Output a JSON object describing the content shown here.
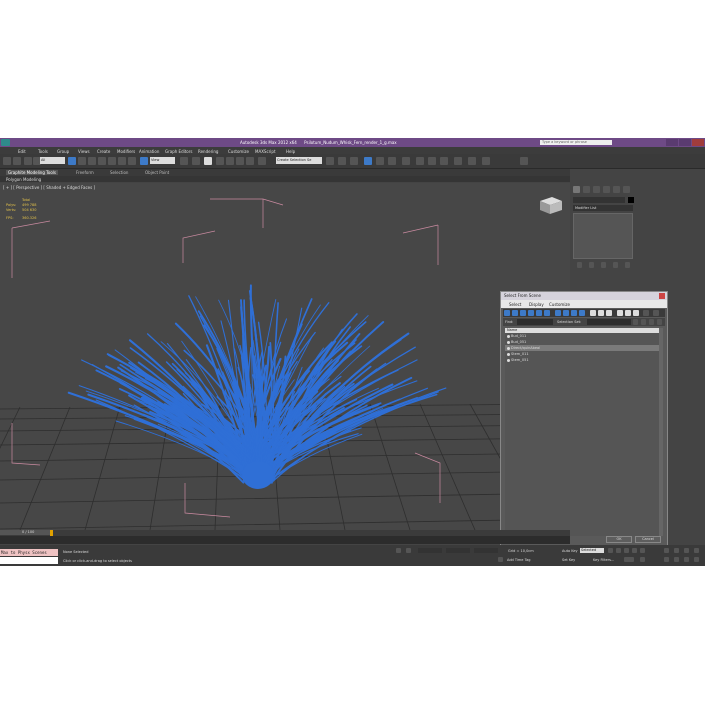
{
  "titlebar": {
    "app_title": "Autodesk 3ds Max 2012 x64",
    "file_name": "Psilotum_Nudum_Whisk_Fern_render_1_g.max",
    "search_placeholder": "Type a keyword or phrase"
  },
  "menubar": {
    "items": [
      "Edit",
      "Tools",
      "Group",
      "Views",
      "Create",
      "Modifiers",
      "Animation",
      "Graph Editors",
      "Rendering",
      "Customize",
      "MAXScript",
      "Help"
    ]
  },
  "toolbar": {
    "filter_value": "All",
    "view_value": "View",
    "selection_set_value": "Create Selection Se"
  },
  "ribbon": {
    "tabs": [
      "Graphite Modeling Tools",
      "Freeform",
      "Selection",
      "Object Paint"
    ],
    "sub_label": "Polygon Modeling"
  },
  "viewport": {
    "label": "[ + ] [ Perspective ] [ Shaded + Edged Faces ]",
    "stats": {
      "total_label": "Total",
      "polys_label": "Polys:",
      "polys_value": "499 788",
      "verts_label": "Verts:",
      "verts_value": "504 630",
      "fps_label": "FPS:",
      "fps_value": "360.326"
    }
  },
  "command_panel": {
    "modifier_list": "Modifier List"
  },
  "dialog": {
    "title": "Select From Scene",
    "menu": [
      "Select",
      "Display",
      "Customize"
    ],
    "find_label": "Find:",
    "selection_set_label": "Selection Set:",
    "list_header": "Name",
    "items": [
      {
        "name": "Bud_011",
        "selected": false
      },
      {
        "name": "Bud_051",
        "selected": false
      },
      {
        "name": "Direct/quinAbeal",
        "selected": true
      },
      {
        "name": "Stem_011",
        "selected": false
      },
      {
        "name": "Stem_051",
        "selected": false
      }
    ],
    "ok_label": "OK",
    "cancel_label": "Cancel"
  },
  "timeline": {
    "frame_display": "0 / 100"
  },
  "statusbar": {
    "maxscript_line1": "Max to Physx Scenes",
    "status_selected": "None Selected",
    "prompt": "Click or click-and-drag to select objects",
    "grid_label": "Grid = 10,0cm",
    "add_time_tag": "Add Time Tag",
    "auto_key": "Auto Key",
    "set_key": "Set Key",
    "selected_dropdown": "Selected",
    "key_filters": "Key Filters..."
  },
  "colors": {
    "titlebar": "#6e4a86",
    "viewport_bg": "#474747",
    "fern": "#2f6fd6",
    "stats_text": "#e3c24a"
  }
}
